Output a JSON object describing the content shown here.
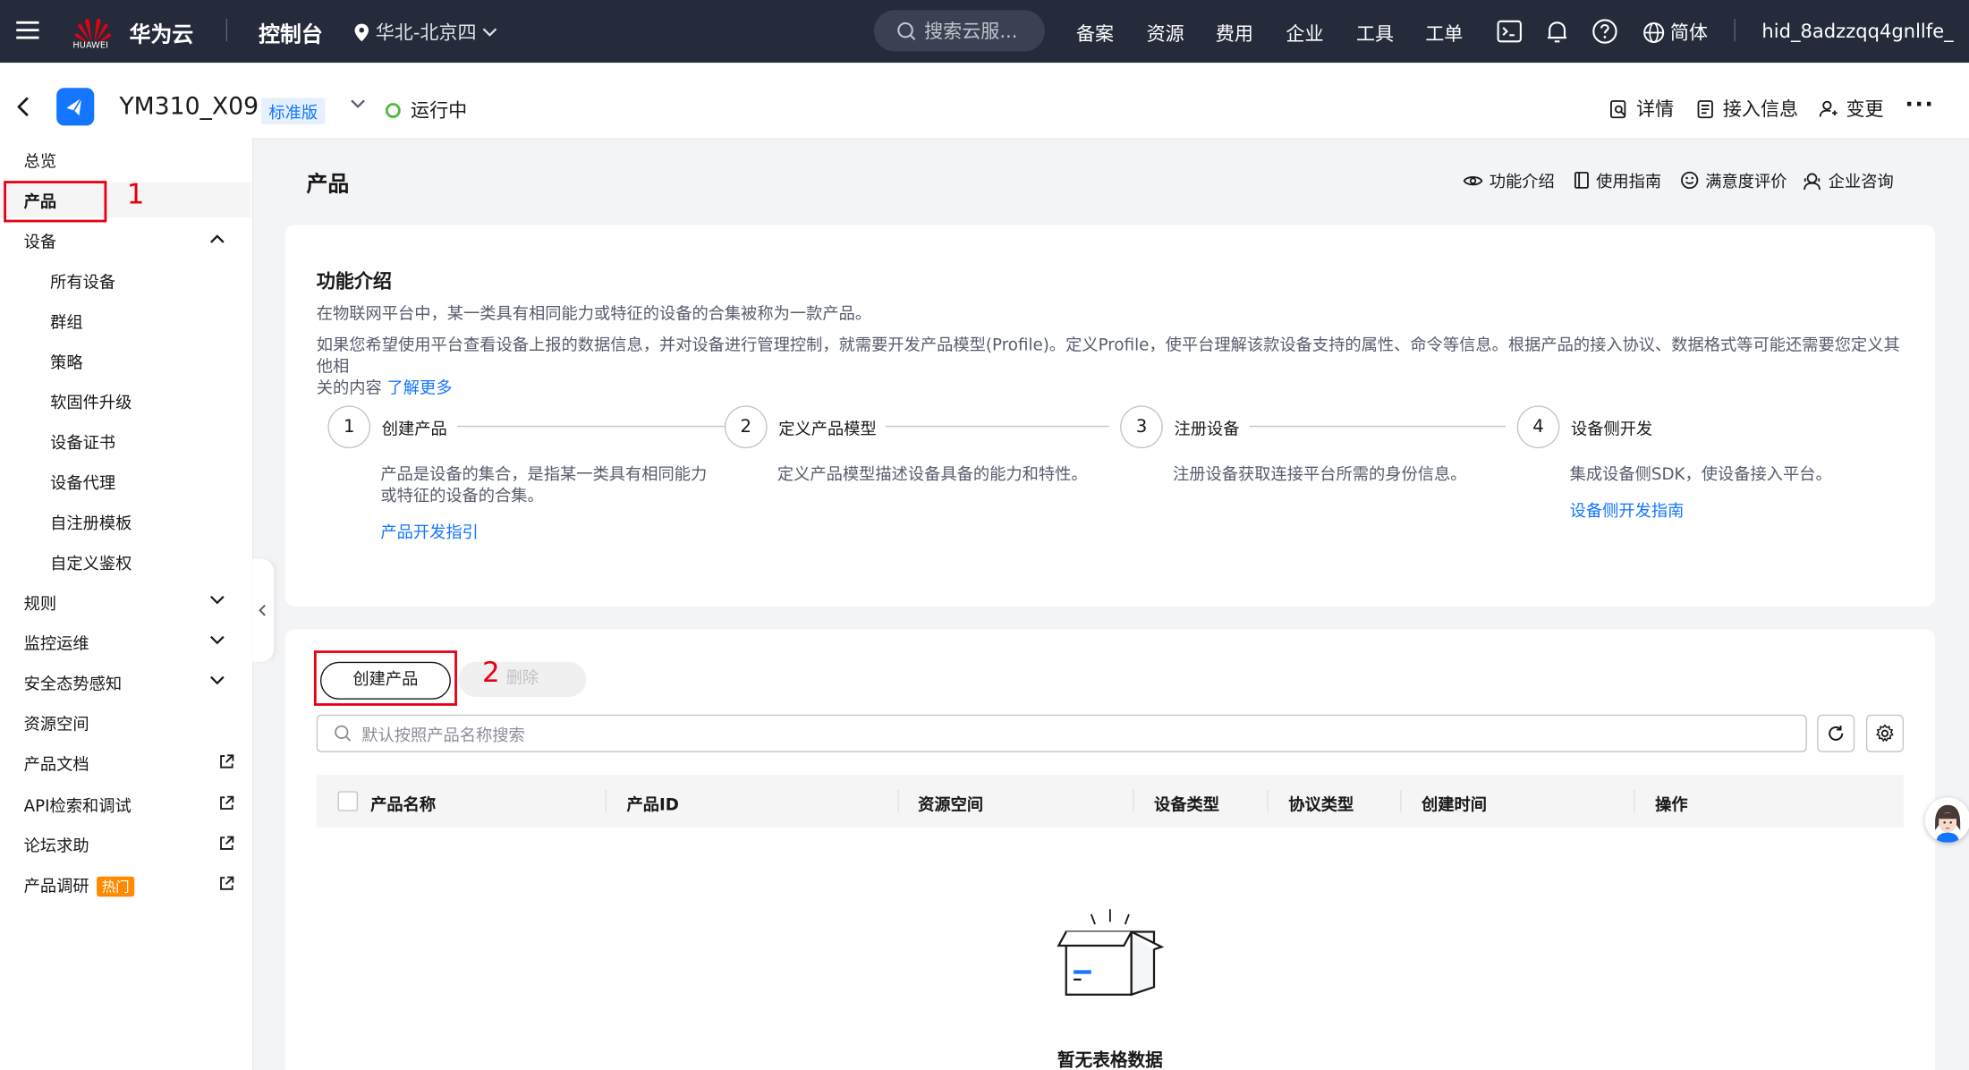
{
  "topbar": {
    "brand": "华为云",
    "logo_text": "HUAWEI",
    "console": "控制台",
    "region": "华北-北京四",
    "search_placeholder": "搜索云服...",
    "nav": [
      "备案",
      "资源",
      "费用",
      "企业",
      "工具",
      "工单"
    ],
    "lang": "简体",
    "user": "hid_8adzzqq4gnllfe_"
  },
  "instance": {
    "name": "YM310_X09",
    "edition": "标准版",
    "status": "运行中",
    "actions": [
      "详情",
      "接入信息",
      "变更"
    ],
    "more": "···"
  },
  "sidebar": {
    "items": [
      {
        "label": "总览"
      },
      {
        "label": "产品"
      },
      {
        "label": "设备"
      },
      {
        "label": "所有设备"
      },
      {
        "label": "群组"
      },
      {
        "label": "策略"
      },
      {
        "label": "软固件升级"
      },
      {
        "label": "设备证书"
      },
      {
        "label": "设备代理"
      },
      {
        "label": "自注册模板"
      },
      {
        "label": "自定义鉴权"
      },
      {
        "label": "规则"
      },
      {
        "label": "监控运维"
      },
      {
        "label": "安全态势感知"
      },
      {
        "label": "资源空间"
      },
      {
        "label": "产品文档"
      },
      {
        "label": "API检索和调试"
      },
      {
        "label": "论坛求助"
      },
      {
        "label": "产品调研"
      }
    ],
    "hot_badge": "热门"
  },
  "annotations": {
    "step1": "1",
    "step2": "2"
  },
  "page": {
    "title": "产品",
    "help_links": [
      "功能介绍",
      "使用指南",
      "满意度评价",
      "企业咨询"
    ]
  },
  "intro": {
    "title": "功能介绍",
    "p1": "在物联网平台中，某一类具有相同能力或特征的设备的合集被称为一款产品。",
    "p2": "如果您希望使用平台查看设备上报的数据信息，并对设备进行管理控制，就需要开发产品模型(Profile)。定义Profile，使平台理解该款设备支持的属性、命令等信息。根据产品的接入协议、数据格式等可能还需要您定义其他相",
    "p3": "关的内容",
    "learn_more": "了解更多",
    "steps": [
      {
        "num": "1",
        "title": "创建产品",
        "desc": "产品是设备的集合，是指某一类具有相同能力或特征的设备的合集。",
        "link": "产品开发指引"
      },
      {
        "num": "2",
        "title": "定义产品模型",
        "desc": "定义产品模型描述设备具备的能力和特性。",
        "link": ""
      },
      {
        "num": "3",
        "title": "注册设备",
        "desc": "注册设备获取连接平台所需的身份信息。",
        "link": ""
      },
      {
        "num": "4",
        "title": "设备侧开发",
        "desc": "集成设备侧SDK，使设备接入平台。",
        "link": "设备侧开发指南"
      }
    ]
  },
  "table": {
    "create_button": "创建产品",
    "delete_button": "删除",
    "search_placeholder": "默认按照产品名称搜索",
    "columns": [
      "产品名称",
      "产品ID",
      "资源空间",
      "设备类型",
      "协议类型",
      "创建时间",
      "操作"
    ],
    "empty_text": "暂无表格数据"
  }
}
